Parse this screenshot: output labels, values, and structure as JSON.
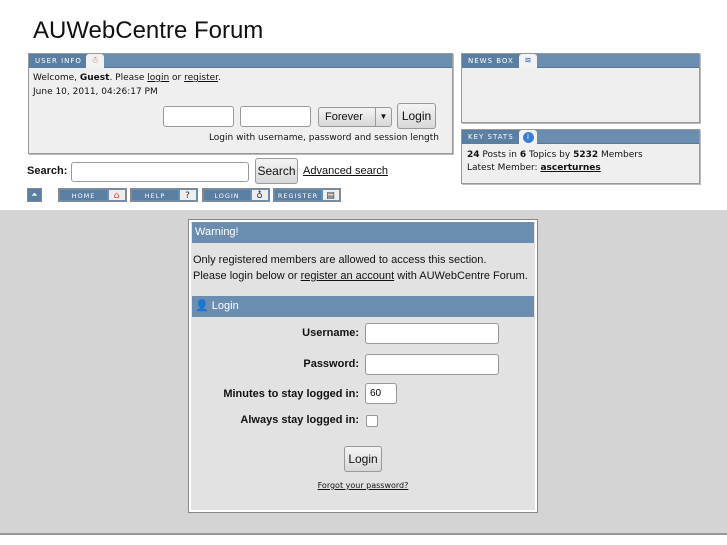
{
  "site_title": "AUWebCentre Forum",
  "user_info": {
    "tab": "USER INFO",
    "welcome_prefix": "Welcome, ",
    "guest": "Guest",
    "please": ". Please ",
    "login_link": "login",
    "or": " or ",
    "register_link": "register",
    "period": ".",
    "date": "June 10, 2011, 04:26:17 PM",
    "session_option": "Forever",
    "login_button": "Login",
    "hint": "Login with username, password and session length"
  },
  "news_box": {
    "tab": "NEWS BOX"
  },
  "key_stats": {
    "tab": "KEY STATS",
    "posts": "24",
    "posts_label": " Posts in ",
    "topics": "6",
    "topics_label": " Topics by ",
    "members": "5232",
    "members_label": " Members",
    "latest_label": "Latest Member: ",
    "latest_member": "ascerturnes"
  },
  "search": {
    "label": "Search:",
    "button": "Search",
    "advanced": "Advanced search"
  },
  "nav": [
    {
      "label": "HOME",
      "icon": "home-icon"
    },
    {
      "label": "HELP",
      "icon": "help-icon"
    },
    {
      "label": "LOGIN",
      "icon": "bulb-icon"
    },
    {
      "label": "REGISTER",
      "icon": "register-icon"
    }
  ],
  "warning": {
    "title": "Warning!",
    "line1": "Only registered members are allowed to access this section.",
    "line2_prefix": "Please login below or ",
    "line2_link": "register an account",
    "line2_suffix": " with AUWebCentre Forum."
  },
  "login": {
    "title": "Login",
    "username_label": "Username:",
    "password_label": "Password:",
    "minutes_label": "Minutes to stay logged in:",
    "minutes_value": "60",
    "always_label": "Always stay logged in:",
    "button": "Login",
    "forgot": "Forgot your password?"
  },
  "colors": {
    "header_blue": "#6a8db0",
    "gray_band": "#d4d4d4"
  }
}
